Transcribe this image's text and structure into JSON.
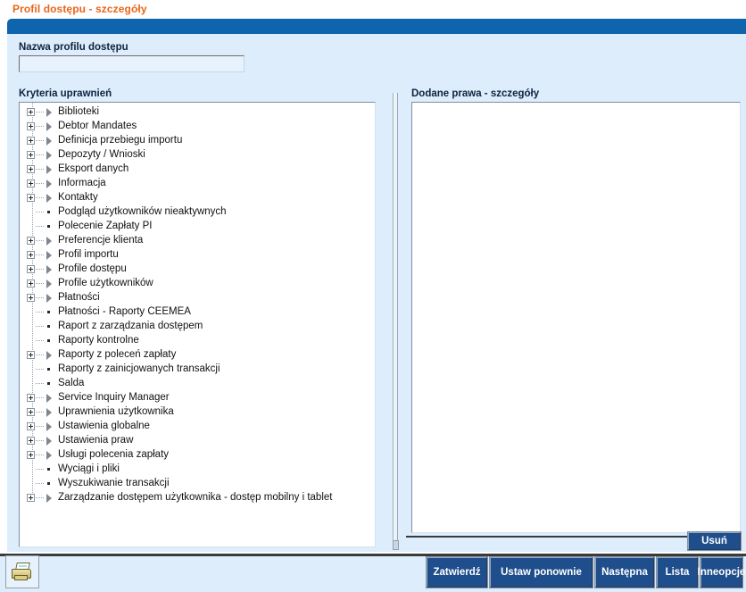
{
  "page": {
    "title": "Profil dostępu - szczegóły"
  },
  "colors": {
    "title_orange": "#E8661A",
    "header_blue": "#0F64AE",
    "form_background": "#DDEDFB",
    "button_blue": "#1F4E8C"
  },
  "form": {
    "profile_name_label": "Nazwa profilu dostępu",
    "profile_name_value": "",
    "profile_name_placeholder": "",
    "criteria_label": "Kryteria uprawnień",
    "rights_label": "Dodane prawa - szczegóły"
  },
  "tree": {
    "items": [
      {
        "label": "Biblioteki",
        "expandable": true
      },
      {
        "label": "Debtor Mandates",
        "expandable": true
      },
      {
        "label": "Definicja przebiegu importu",
        "expandable": true
      },
      {
        "label": "Depozyty / Wnioski",
        "expandable": true
      },
      {
        "label": "Eksport danych",
        "expandable": true
      },
      {
        "label": "Informacja",
        "expandable": true
      },
      {
        "label": "Kontakty",
        "expandable": true
      },
      {
        "label": "Podgląd użytkowników nieaktywnych",
        "expandable": false
      },
      {
        "label": "Polecenie Zapłaty PI",
        "expandable": false
      },
      {
        "label": "Preferencje klienta",
        "expandable": true
      },
      {
        "label": "Profil importu",
        "expandable": true
      },
      {
        "label": "Profile dostępu",
        "expandable": true
      },
      {
        "label": "Profile użytkowników",
        "expandable": true
      },
      {
        "label": "Płatności",
        "expandable": true
      },
      {
        "label": "Płatności - Raporty CEEMEA",
        "expandable": false
      },
      {
        "label": "Raport z zarządzania dostępem",
        "expandable": false
      },
      {
        "label": "Raporty kontrolne",
        "expandable": false
      },
      {
        "label": "Raporty z poleceń zapłaty",
        "expandable": true
      },
      {
        "label": "Raporty z zainicjowanych transakcji",
        "expandable": false
      },
      {
        "label": "Salda",
        "expandable": false
      },
      {
        "label": "Service Inquiry Manager",
        "expandable": true
      },
      {
        "label": "Uprawnienia użytkownika",
        "expandable": true
      },
      {
        "label": "Ustawienia globalne",
        "expandable": true
      },
      {
        "label": "Ustawienia praw",
        "expandable": true
      },
      {
        "label": "Usługi polecenia zapłaty",
        "expandable": true
      },
      {
        "label": "Wyciągi i pliki",
        "expandable": false
      },
      {
        "label": "Wyszukiwanie transakcji",
        "expandable": false
      },
      {
        "label": "Zarządzanie dostępem użytkownika - dostęp mobilny i tablet",
        "expandable": true
      }
    ]
  },
  "rights_panel": {
    "items": []
  },
  "actions": {
    "delete_label": "Usuń",
    "confirm_label": "Zatwierdź",
    "reset_label": "Ustaw ponownie",
    "next_label": "Następna",
    "list_label": "Lista",
    "other_options_line1": "Inne",
    "other_options_line2": "opcje",
    "print_icon": "printer-icon"
  }
}
